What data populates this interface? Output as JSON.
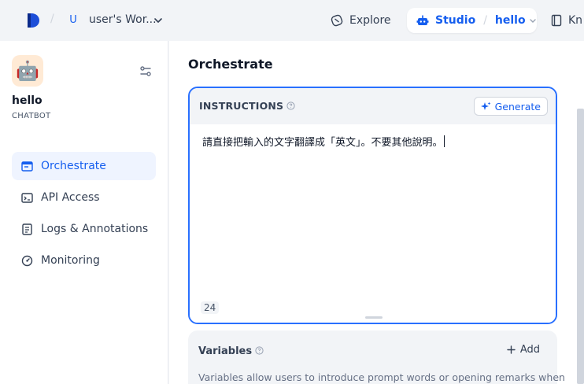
{
  "workspace": {
    "avatar_letter": "U",
    "name": "user's Wor..."
  },
  "top_nav": {
    "explore_label": "Explore",
    "studio_label": "Studio",
    "current_app": "hello",
    "knowledge_label": "Kn"
  },
  "app": {
    "name": "hello",
    "mode": "CHATBOT",
    "icon": "🤖"
  },
  "sidebar": {
    "items": [
      {
        "label": "Orchestrate",
        "icon": "terminal-window-icon",
        "active": true
      },
      {
        "label": "API Access",
        "icon": "code-terminal-icon",
        "active": false
      },
      {
        "label": "Logs & Annotations",
        "icon": "file-list-icon",
        "active": false
      },
      {
        "label": "Monitoring",
        "icon": "dashboard-gauge-icon",
        "active": false
      }
    ]
  },
  "main": {
    "title": "Orchestrate",
    "instructions": {
      "label": "INSTRUCTIONS",
      "generate_label": "Generate",
      "text": "請直接把輸入的文字翻譯成「英文」。不要其他說明。",
      "char_count": "24"
    },
    "variables": {
      "label": "Variables",
      "add_label": "Add",
      "description": "Variables allow users to introduce prompt words or opening remarks when"
    }
  },
  "colors": {
    "accent": "#155eef",
    "focus_border": "#2970ff",
    "active_nav_bg": "#eff4ff",
    "app_icon_bg": "#ffead5"
  }
}
